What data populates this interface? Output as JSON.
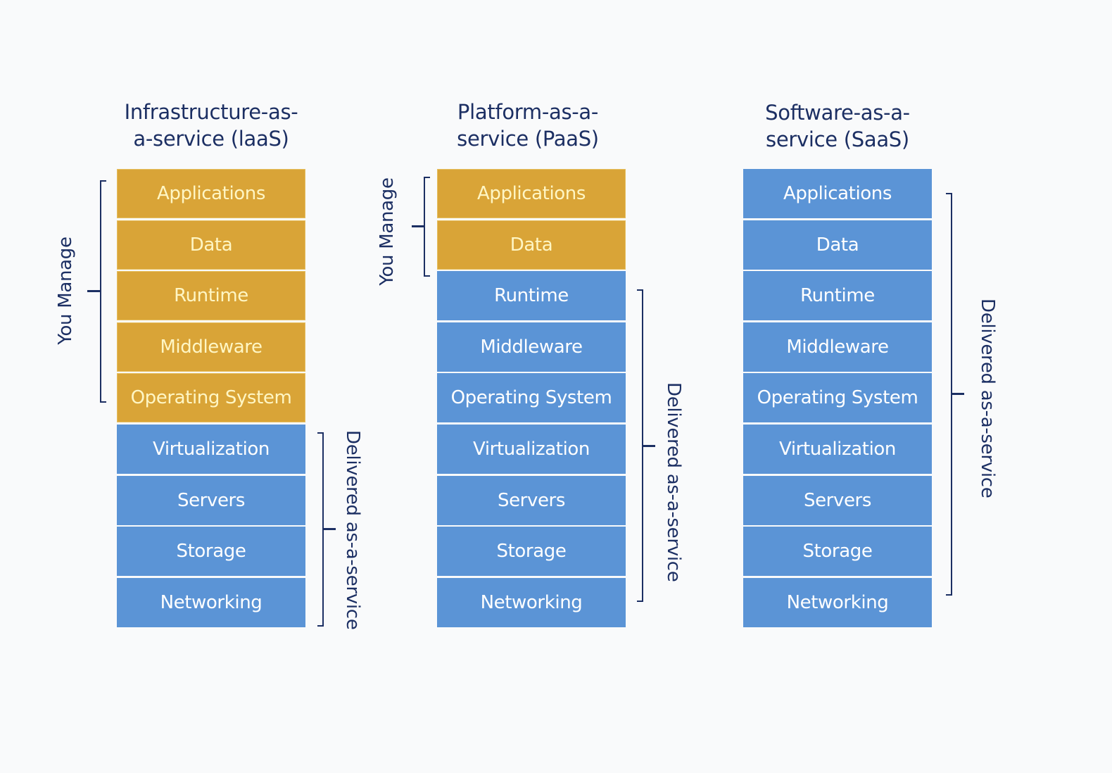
{
  "diagram": {
    "columns": [
      {
        "id": "iaas",
        "title": "Infrastructure-as-\na-service (laaS)",
        "layers": [
          {
            "label": "Applications",
            "group": "managed"
          },
          {
            "label": "Data",
            "group": "managed"
          },
          {
            "label": "Runtime",
            "group": "managed"
          },
          {
            "label": "Middleware",
            "group": "managed"
          },
          {
            "label": "Operating System",
            "group": "managed"
          },
          {
            "label": "Virtualization",
            "group": "delivered"
          },
          {
            "label": "Servers",
            "group": "delivered"
          },
          {
            "label": "Storage",
            "group": "delivered"
          },
          {
            "label": "Networking",
            "group": "delivered"
          }
        ],
        "you_manage_label": "You Manage",
        "delivered_label": "Delivered as-a-service"
      },
      {
        "id": "paas",
        "title": "Platform-as-a-\nservice (PaaS)",
        "layers": [
          {
            "label": "Applications",
            "group": "managed"
          },
          {
            "label": "Data",
            "group": "managed"
          },
          {
            "label": "Runtime",
            "group": "delivered"
          },
          {
            "label": "Middleware",
            "group": "delivered"
          },
          {
            "label": "Operating System",
            "group": "delivered"
          },
          {
            "label": "Virtualization",
            "group": "delivered"
          },
          {
            "label": "Servers",
            "group": "delivered"
          },
          {
            "label": "Storage",
            "group": "delivered"
          },
          {
            "label": "Networking",
            "group": "delivered"
          }
        ],
        "you_manage_label": "You Manage",
        "delivered_label": "Delivered as-a-service"
      },
      {
        "id": "saas",
        "title": "Software-as-a-\nservice (SaaS)",
        "layers": [
          {
            "label": "Applications",
            "group": "delivered"
          },
          {
            "label": "Data",
            "group": "delivered"
          },
          {
            "label": "Runtime",
            "group": "delivered"
          },
          {
            "label": "Middleware",
            "group": "delivered"
          },
          {
            "label": "Operating System",
            "group": "delivered"
          },
          {
            "label": "Virtualization",
            "group": "delivered"
          },
          {
            "label": "Servers",
            "group": "delivered"
          },
          {
            "label": "Storage",
            "group": "delivered"
          },
          {
            "label": "Networking",
            "group": "delivered"
          }
        ],
        "delivered_label": "Delivered as-a-service"
      }
    ],
    "colors": {
      "managed": "#d9a437",
      "managed_text": "#fff6c4",
      "delivered": "#5b94d6",
      "delivered_text": "#ffffff",
      "ink": "#1c2f63",
      "background": "#f9fafb"
    }
  }
}
